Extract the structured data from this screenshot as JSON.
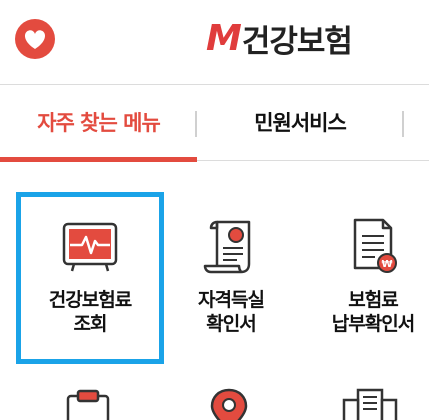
{
  "header": {
    "brand_mark": "M",
    "brand_name": "건강보험"
  },
  "tabs": [
    {
      "label": "자주 찾는 메뉴",
      "active": true
    },
    {
      "label": "민원서비스",
      "active": false
    }
  ],
  "menu": {
    "items": [
      {
        "line1": "건강보험료",
        "line2": "조회",
        "icon": "monitor-heartbeat-icon",
        "selected": true
      },
      {
        "line1": "자격득실",
        "line2": "확인서",
        "icon": "certificate-scroll-icon",
        "selected": false
      },
      {
        "line1": "보험료",
        "line2": "납부확인서",
        "icon": "payment-document-icon",
        "selected": false
      }
    ],
    "next_row_icons": [
      "clipboard-icon",
      "location-pin-icon",
      "building-icon"
    ]
  },
  "colors": {
    "accent": "#e34b3f",
    "selection": "#1aa3e8",
    "text": "#111111"
  }
}
